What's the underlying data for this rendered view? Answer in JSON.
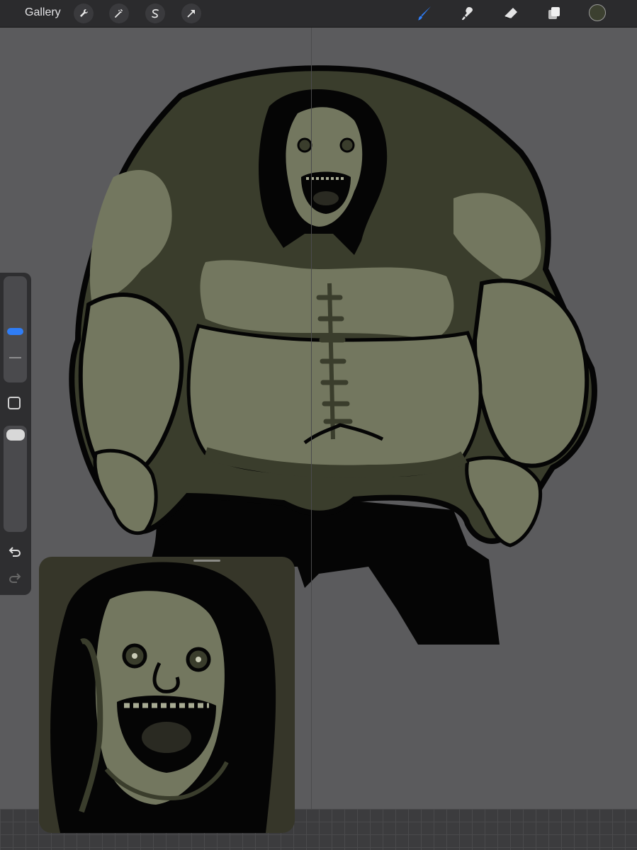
{
  "toolbar": {
    "gallery_label": "Gallery",
    "left_tools": [
      "wrench-icon",
      "magic-wand-icon",
      "selection-s-icon",
      "transform-arrow-icon"
    ],
    "right_tools": [
      "brush-icon",
      "smudge-icon",
      "eraser-icon",
      "layers-icon"
    ],
    "current_color": "#3c4030",
    "active_tool_color": "#2f7df6"
  },
  "sidebar": {
    "brush_size_level": 0.55,
    "opacity_level": 0.02,
    "undo_icon": "undo-icon",
    "redo_icon": "redo-icon"
  },
  "canvas": {
    "background": "#5b5b5d",
    "skin_light": "#73775f",
    "skin_dark": "#3a3d2c",
    "ink": "#050505"
  },
  "reference": {
    "background": "#363629"
  }
}
